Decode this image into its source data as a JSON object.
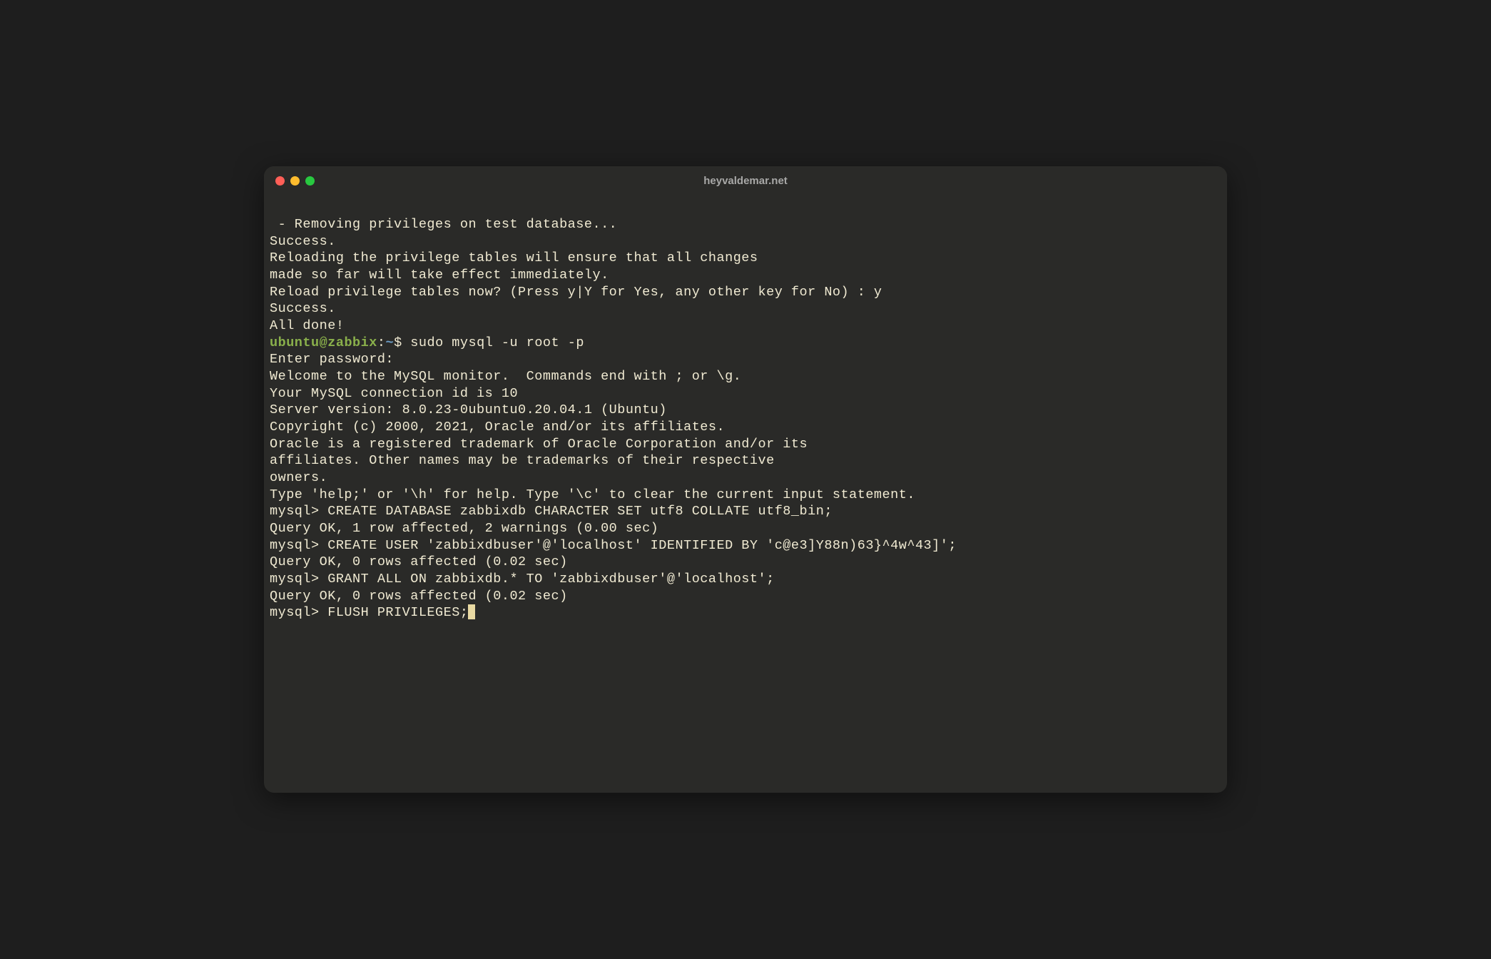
{
  "window": {
    "title": "heyvaldemar.net"
  },
  "prompt": {
    "user": "ubuntu",
    "at": "@",
    "host": "zabbix",
    "colon": ":",
    "path": "~",
    "dollar": "$ "
  },
  "lines": {
    "l01": " - Removing privileges on test database...",
    "l02": "Success.",
    "l03": "",
    "l04": "Reloading the privilege tables will ensure that all changes",
    "l05": "made so far will take effect immediately.",
    "l06": "",
    "l07": "Reload privilege tables now? (Press y|Y for Yes, any other key for No) : y",
    "l08": "Success.",
    "l09": "",
    "l10": "All done!",
    "cmd1": "sudo mysql -u root -p",
    "l11": "Enter password:",
    "l12": "Welcome to the MySQL monitor.  Commands end with ; or \\g.",
    "l13": "Your MySQL connection id is 10",
    "l14": "Server version: 8.0.23-0ubuntu0.20.04.1 (Ubuntu)",
    "l15": "",
    "l16": "Copyright (c) 2000, 2021, Oracle and/or its affiliates.",
    "l17": "",
    "l18": "Oracle is a registered trademark of Oracle Corporation and/or its",
    "l19": "affiliates. Other names may be trademarks of their respective",
    "l20": "owners.",
    "l21": "",
    "l22": "Type 'help;' or '\\h' for help. Type '\\c' to clear the current input statement.",
    "l23": "",
    "l24": "mysql> CREATE DATABASE zabbixdb CHARACTER SET utf8 COLLATE utf8_bin;",
    "l25": "Query OK, 1 row affected, 2 warnings (0.00 sec)",
    "l26": "",
    "l27": "mysql> CREATE USER 'zabbixdbuser'@'localhost' IDENTIFIED BY 'c@e3]Y88n)63}^4w^43]';",
    "l28": "Query OK, 0 rows affected (0.02 sec)",
    "l29": "",
    "l30": "mysql> GRANT ALL ON zabbixdb.* TO 'zabbixdbuser'@'localhost';",
    "l31": "Query OK, 0 rows affected (0.02 sec)",
    "l32": "",
    "l33": "mysql> FLUSH PRIVILEGES;"
  }
}
